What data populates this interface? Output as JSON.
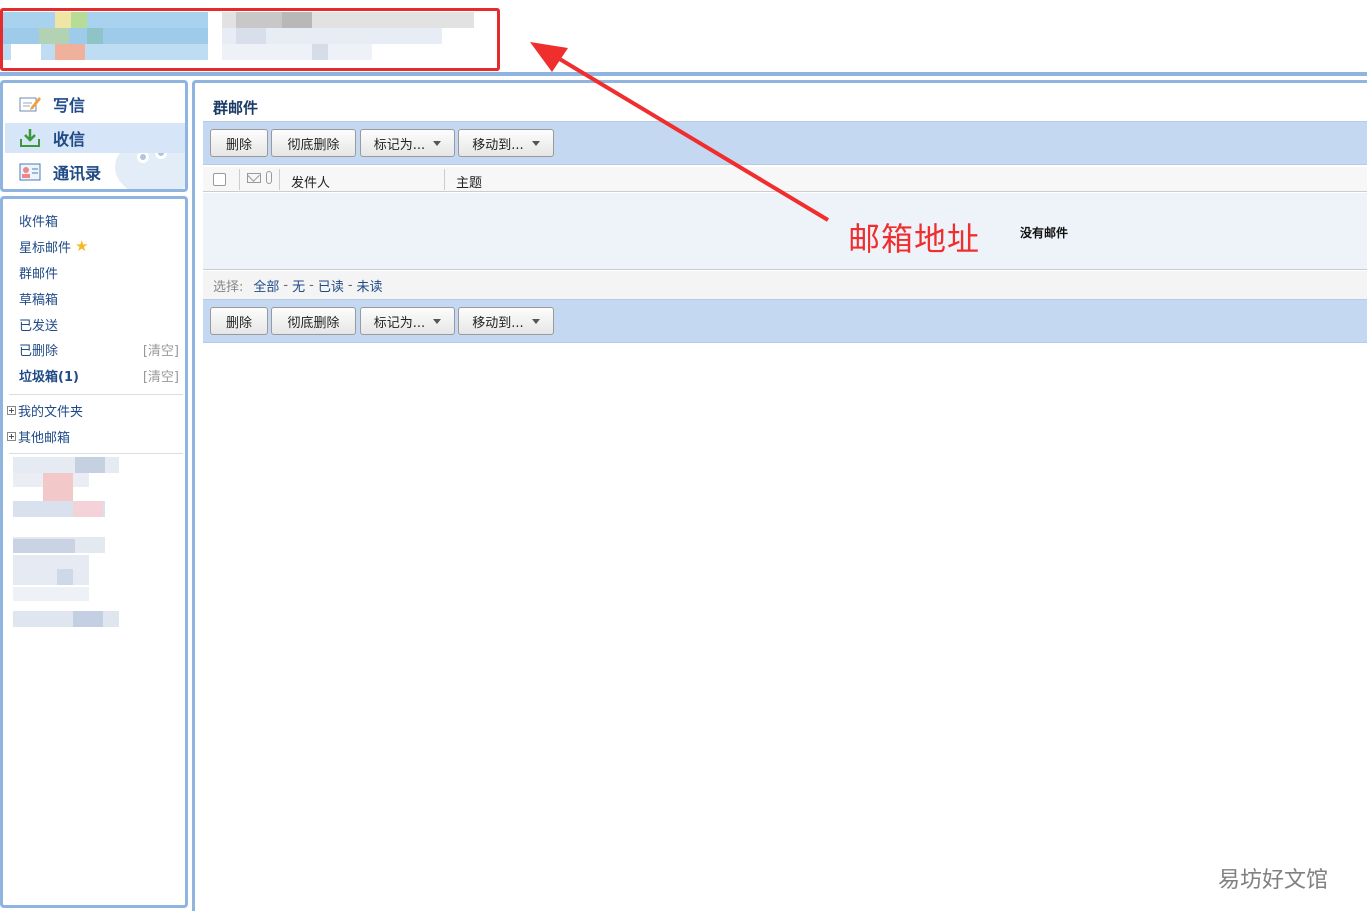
{
  "colors": {
    "accent_border": "#8fb4e0",
    "toolbar_bg": "#c4d9f1",
    "link": "#1f4a86",
    "annotation_red": "#e52b2b"
  },
  "sidebar": {
    "nav": [
      {
        "label": "写信",
        "icon": "compose-icon"
      },
      {
        "label": "收信",
        "icon": "inbox-download-icon"
      },
      {
        "label": "通讯录",
        "icon": "contacts-icon"
      }
    ],
    "folders": [
      {
        "label": "收件箱"
      },
      {
        "label": "星标邮件",
        "icon": "star-icon"
      },
      {
        "label": "群邮件"
      },
      {
        "label": "草稿箱"
      },
      {
        "label": "已发送"
      },
      {
        "label": "已删除",
        "action": "[清空]"
      },
      {
        "label": "垃圾箱(1)",
        "action": "[清空]"
      }
    ],
    "trees": [
      {
        "label": "我的文件夹"
      },
      {
        "label": "其他邮箱"
      }
    ]
  },
  "main": {
    "title": "群邮件",
    "toolbar": {
      "delete": "删除",
      "delete_permanently": "彻底删除",
      "mark_as": "标记为...",
      "move_to": "移动到..."
    },
    "list_header": {
      "sender": "发件人",
      "subject": "主题"
    },
    "empty_message": "没有邮件",
    "select": {
      "label": "选择:",
      "all": "全部",
      "none": "无",
      "read": "已读",
      "unread": "未读"
    }
  },
  "annotation": {
    "text": "邮箱地址"
  },
  "watermark": "易坊好文馆"
}
